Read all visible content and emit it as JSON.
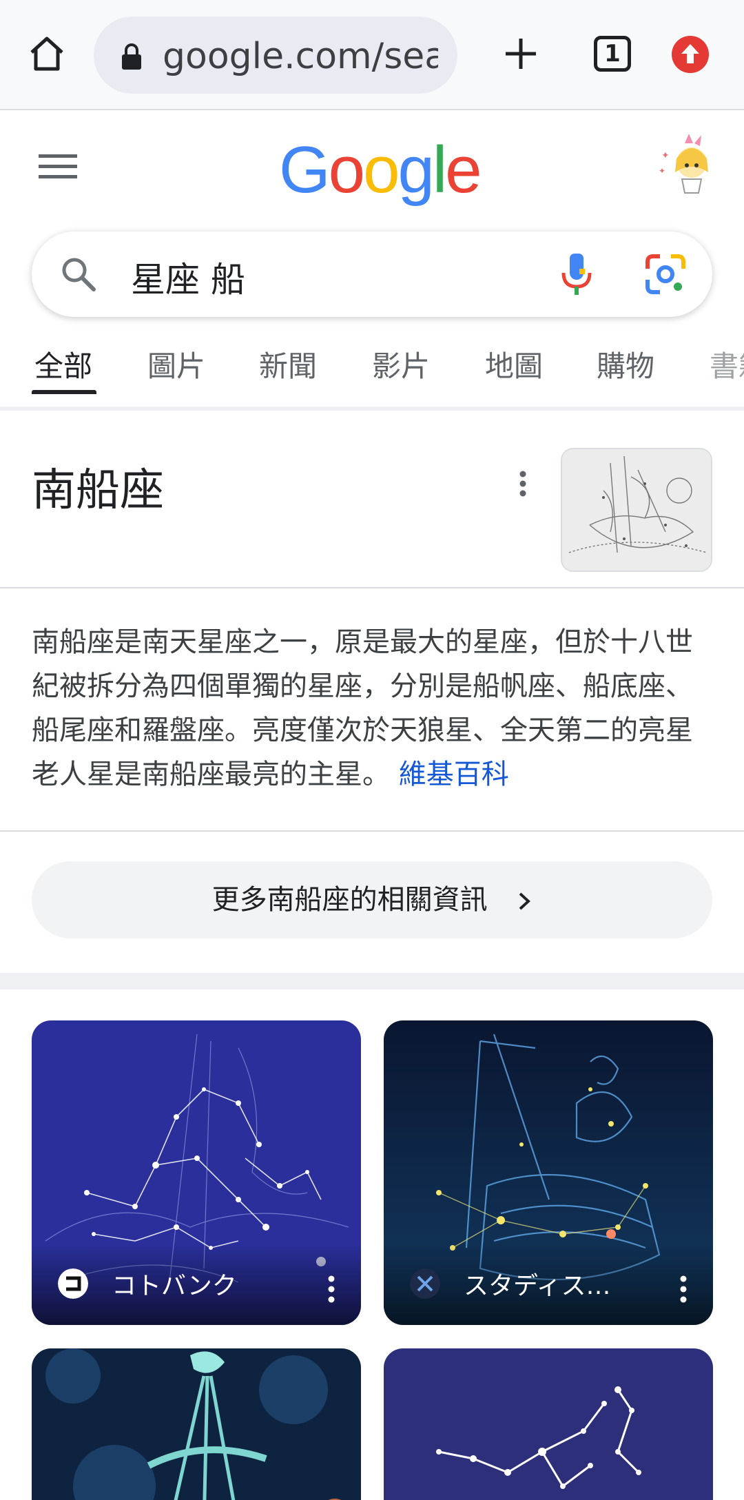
{
  "browser": {
    "url": "google.com/search",
    "tab_count": "1"
  },
  "google": {
    "logo_letters": [
      "G",
      "o",
      "o",
      "g",
      "l",
      "e"
    ],
    "logo_colors": [
      "#4285F4",
      "#EA4335",
      "#FBBC05",
      "#4285F4",
      "#34A853",
      "#EA4335"
    ]
  },
  "search": {
    "query": "星座 船"
  },
  "tabs": [
    {
      "label": "全部",
      "active": true
    },
    {
      "label": "圖片"
    },
    {
      "label": "新聞"
    },
    {
      "label": "影片"
    },
    {
      "label": "地圖"
    },
    {
      "label": "購物"
    },
    {
      "label": "書籍"
    }
  ],
  "knowledge_panel": {
    "title": "南船座",
    "description": "南船座是南天星座之一，原是最大的星座，但於十八世紀被拆分為四個單獨的星座，分別是船帆座、船底座、船尾座和羅盤座。亮度僅次於天狼星、全天第二的亮星老人星是南船座最亮的主星。",
    "source_link": "維基百科",
    "more_info_label": "更多南船座的相關資訊"
  },
  "images": [
    {
      "source": "コトバンク"
    },
    {
      "source": "スタディス…"
    }
  ],
  "colors": {
    "link": "#1558d6",
    "card1_bg": "#2a2f9c",
    "card2_bg": "#0c1d3a",
    "update_red": "#e53935"
  }
}
